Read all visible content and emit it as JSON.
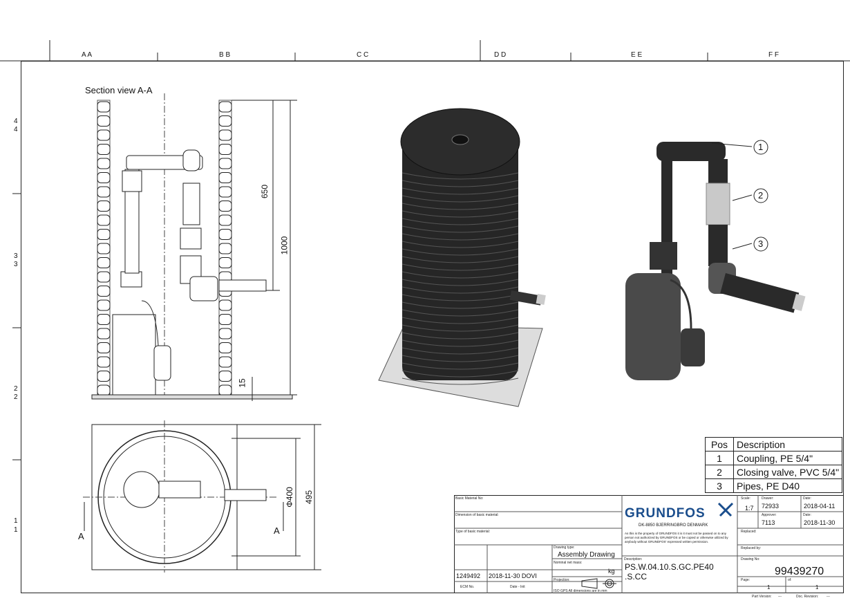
{
  "zones": {
    "top": [
      {
        "pair": "A A"
      },
      {
        "pair": "B B"
      },
      {
        "pair": "C C"
      },
      {
        "pair": "D D"
      },
      {
        "pair": "E E"
      },
      {
        "pair": "F F"
      }
    ],
    "left": [
      "4",
      "4",
      "3",
      "3",
      "2",
      "2",
      "1",
      "1"
    ]
  },
  "section_title": "Section view A-A",
  "dimensions": {
    "height_650": "650",
    "height_1000": "1000",
    "base_15": "15",
    "diameter_400": "Φ400",
    "width_495": "495",
    "section_mark": "A"
  },
  "callouts": [
    "1",
    "2",
    "3"
  ],
  "parts_table": {
    "headers": [
      "Pos",
      "Description"
    ],
    "rows": [
      {
        "pos": "1",
        "desc": "Coupling, PE 5/4\""
      },
      {
        "pos": "2",
        "desc": "Closing valve, PVC 5/4\""
      },
      {
        "pos": "3",
        "desc": "Pipes, PE D40"
      }
    ]
  },
  "title_block": {
    "basic_material": "Basic Material No:",
    "dimension_material": "Dimension of basic material:",
    "type_material": "Type of basic material:",
    "drawing_type_label": "Drawing type:",
    "drawing_type": "Assembly Drawing",
    "nominal_mass_label": "Nominal net mass:",
    "mass_unit": "kg",
    "projection_label": "Projection:",
    "iso_note": "ISO GPS   All dimensions are in mm",
    "ecm_value": "1249492",
    "ecm_date": "2018-11-30 DOVI",
    "ecm_label": "ECM No.",
    "date_label": "Date - Init",
    "logo": "GRUNDFOS",
    "address": "DK-8850 BJERRINGBRO DENMARK",
    "disclaimer": "As this is the property of GRUNDFOS it is it must not be passed on to any person not authorized by GRUNDFOS or be copied or otherwise utilized by anybody without GRUNDFOS' expressed written permission.",
    "description_label": "Description:",
    "description": "PS.W.04.10.S.GC.PE40 .S.CC",
    "scale_label": "Scale:",
    "scale": "1:7",
    "drawer_label": "Drawer:",
    "drawer": "72933",
    "approver_label": "Approver:",
    "approver": "7113",
    "date1_label": "Date:",
    "date1": "2018-04-11",
    "date2_label": "Date:",
    "date2": "2018-11-30",
    "replaced_label": "Replaced:",
    "replaced_by_label": "Replaced by:",
    "drawing_no_label": "Drawing No:",
    "drawing_no": "99439270",
    "page_label": "Page:",
    "page": "1",
    "of_label": "of:",
    "of": "1",
    "part_version_label": "Part Version:",
    "part_version": "---",
    "doc_revision_label": "Doc. Revision:",
    "doc_revision": "---"
  }
}
